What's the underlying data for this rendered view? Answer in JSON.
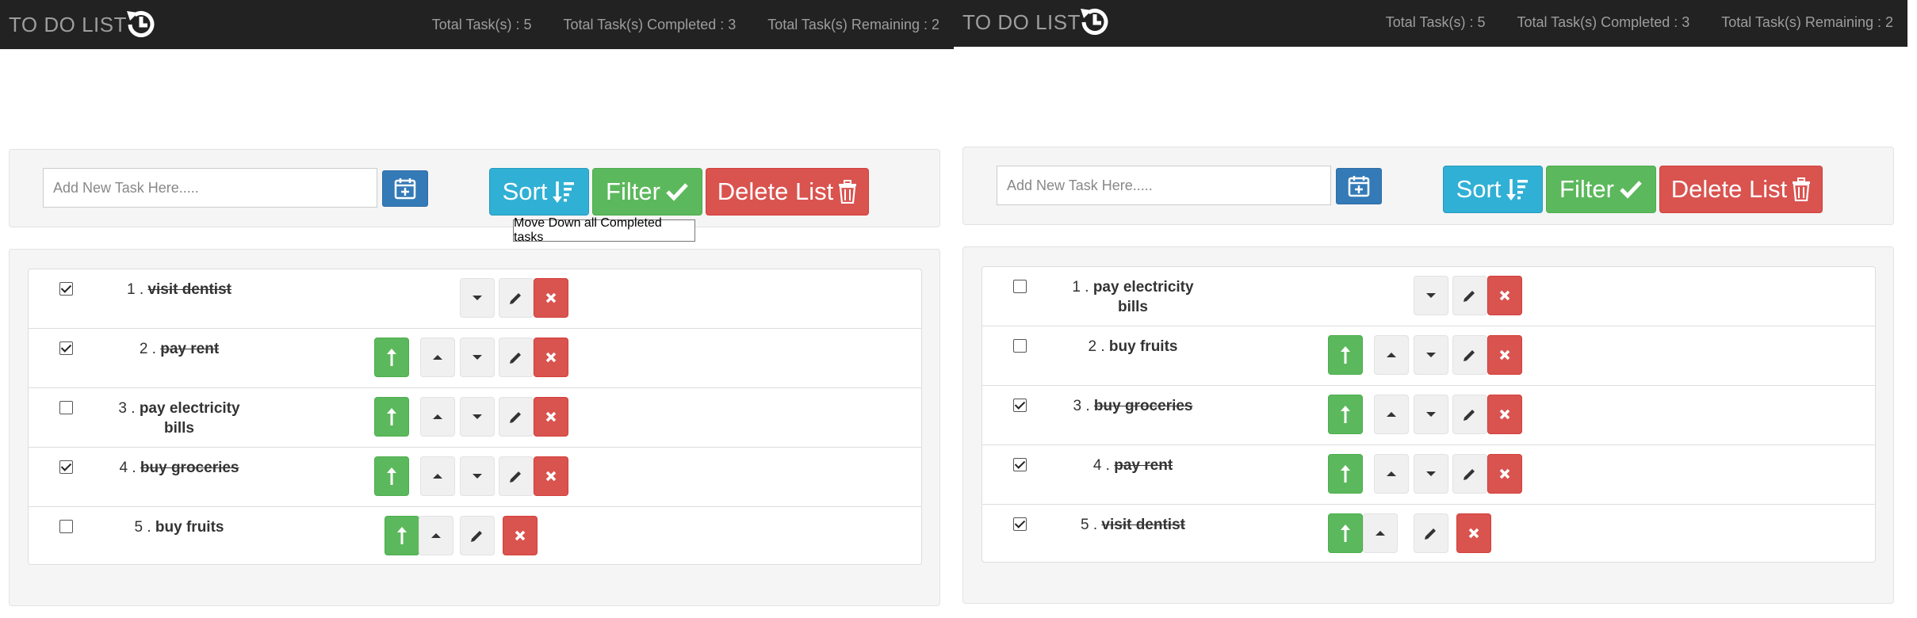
{
  "header": {
    "brand": "TO DO LIST",
    "icon": "history-icon",
    "stats": {
      "total": "Total Task(s) : 5",
      "completed": "Total Task(s) Completed : 3",
      "remaining": "Total Task(s) Remaining : 2"
    }
  },
  "toolbar": {
    "input_placeholder": "Add New Task Here.....",
    "add_icon": "calendar-plus-icon",
    "sort_label": "Sort",
    "filter_label": "Filter",
    "delete_label": "Delete List"
  },
  "tooltip": "Move Down all Completed tasks",
  "colors": {
    "navbar": "#222222",
    "primary": "#337ab7",
    "info": "#31b0d5",
    "success": "#5cb85c",
    "danger": "#d9534f"
  },
  "left_list": [
    {
      "num": "1 .",
      "text": "visit dentist",
      "checked": true
    },
    {
      "num": "2 .",
      "text": "pay rent",
      "checked": true
    },
    {
      "num": "3 .",
      "text": "pay electricity bills",
      "checked": false
    },
    {
      "num": "4 .",
      "text": "buy groceries",
      "checked": true
    },
    {
      "num": "5 .",
      "text": "buy fruits",
      "checked": false
    }
  ],
  "right_list": [
    {
      "num": "1 .",
      "text": "pay electricity bills",
      "checked": false
    },
    {
      "num": "2 .",
      "text": "buy fruits",
      "checked": false
    },
    {
      "num": "3 .",
      "text": "buy groceries",
      "checked": true
    },
    {
      "num": "4 .",
      "text": "pay rent",
      "checked": true
    },
    {
      "num": "5 .",
      "text": "visit dentist",
      "checked": true
    }
  ]
}
